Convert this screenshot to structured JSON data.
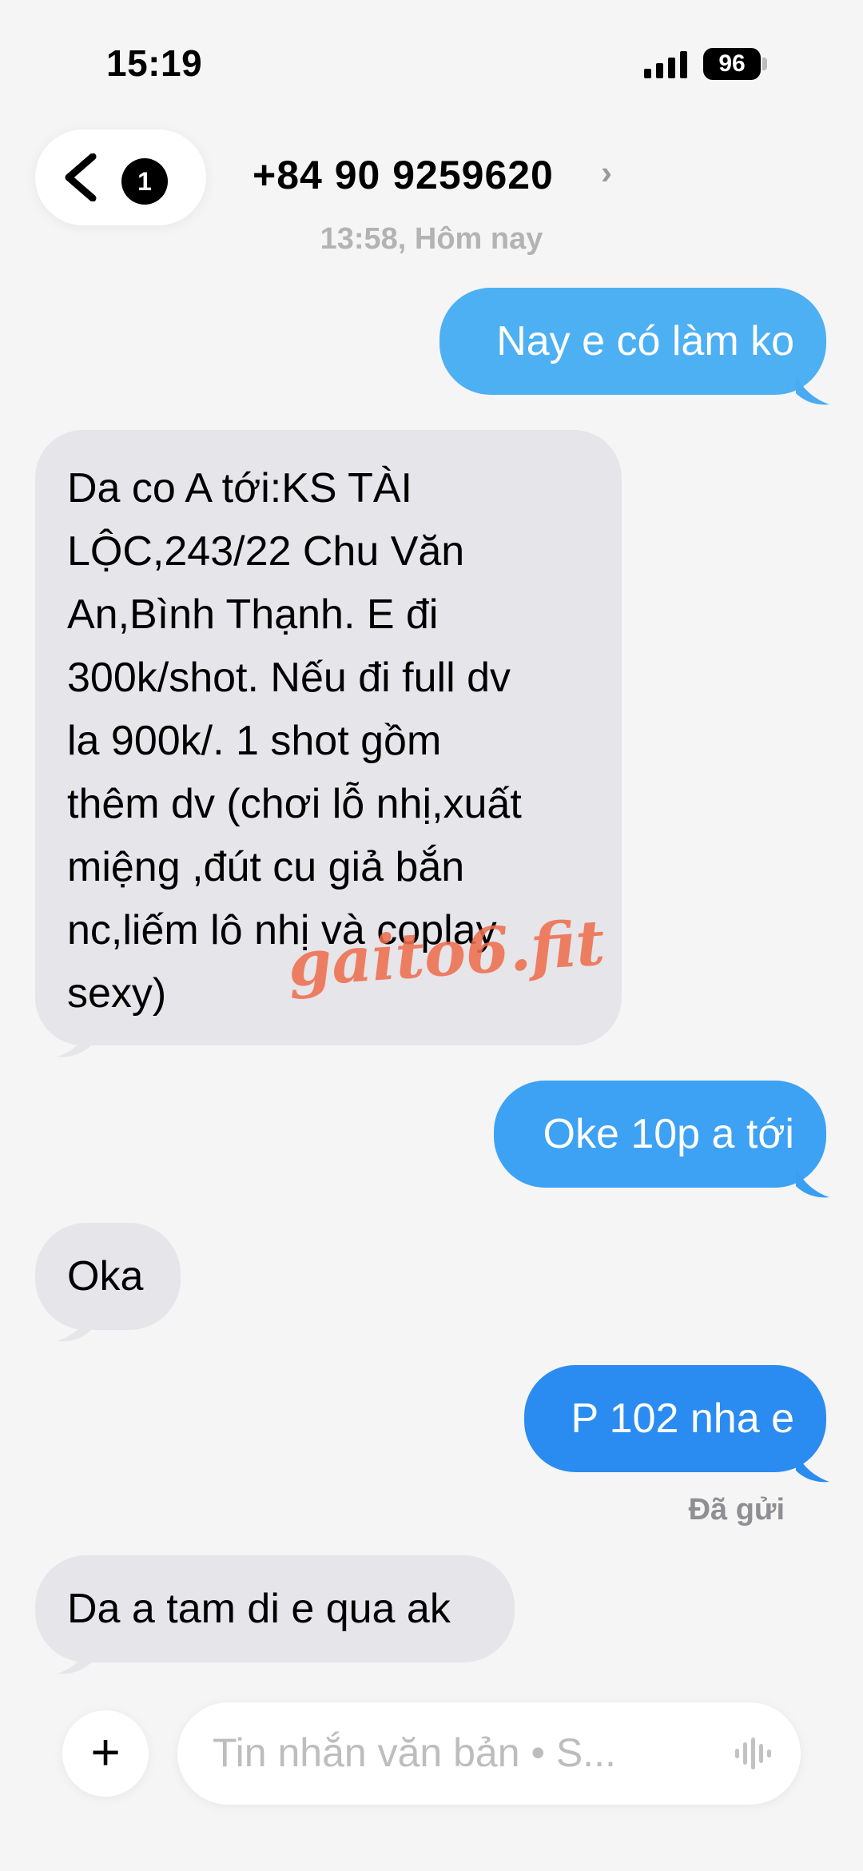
{
  "status_bar": {
    "time": "15:19",
    "battery": "96"
  },
  "header": {
    "back_badge": "1",
    "contact": "+84 90 9259620",
    "chevron": "›"
  },
  "conversation": {
    "timestamp": "13:58, Hôm nay",
    "messages": [
      {
        "direction": "outgoing",
        "text": "Nay e có làm ko"
      },
      {
        "direction": "incoming",
        "lines": [
          "Da co A tới:KS TÀI",
          "LỘC,243/22 Chu Văn",
          "An,Bình Thạnh. E đi",
          "300k/shot. Nếu đi full dv",
          "la 900k/. 1 shot gồm",
          "thêm dv (chơi lỗ nhị,xuất",
          "miệng ,đút cu giả bắn",
          "nc,liếm lô nhị và coplay",
          "sexy)"
        ]
      },
      {
        "direction": "outgoing",
        "text": "Oke 10p a tới"
      },
      {
        "direction": "incoming",
        "text": "Oka"
      },
      {
        "direction": "outgoing",
        "text": "P 102 nha e"
      },
      {
        "direction": "incoming",
        "text": "Da a tam di e qua ak"
      }
    ],
    "delivered_status": "Đã gửi"
  },
  "watermark": "gaito6.fit",
  "composer": {
    "add_symbol": "+",
    "placeholder": "Tin nhắn văn bản • S..."
  },
  "colors": {
    "outgoing_top": "#4db0f3",
    "outgoing_bottom": "#2a8cf0",
    "incoming": "#e5e5ea",
    "background": "#f5f5f5",
    "watermark": "#ef6f4f"
  }
}
